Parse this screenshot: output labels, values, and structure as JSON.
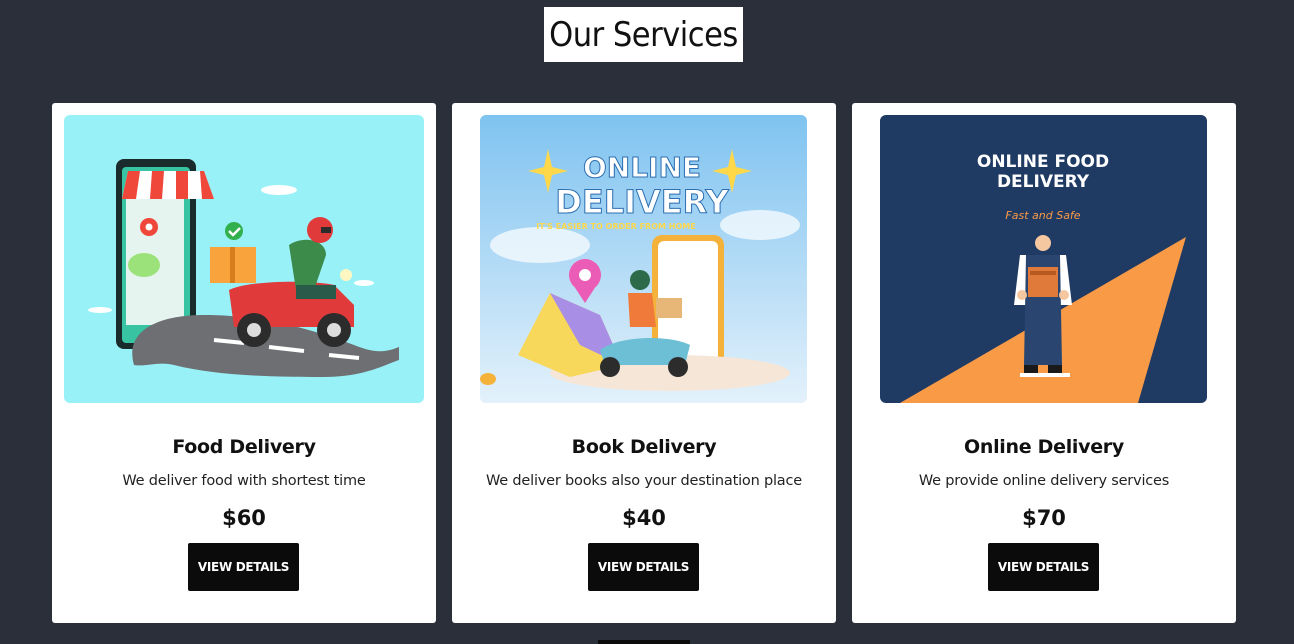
{
  "page": {
    "title": "Our Services"
  },
  "cards": [
    {
      "title": "Food Delivery",
      "description": "We deliver food with shortest time",
      "price": "$60",
      "button_label": "VIEW DETAILS",
      "image": {
        "icon": "scooter-delivery-illustration",
        "bg": "#98f1f6"
      }
    },
    {
      "title": "Book Delivery",
      "description": "We deliver books also your destination place",
      "price": "$40",
      "button_label": "VIEW DETAILS",
      "image": {
        "icon": "online-delivery-banner",
        "headline_1": "ONLINE",
        "headline_2": "DELIVERY",
        "tagline": "IT'S EASIER TO ORDER FROM HOME",
        "bg": "#bfe1f7"
      }
    },
    {
      "title": "Online Delivery",
      "description": "We provide online delivery services",
      "price": "$70",
      "button_label": "VIEW DETAILS",
      "image": {
        "icon": "delivery-man-illustration",
        "headline_1": "ONLINE FOOD",
        "headline_2": "DELIVERY",
        "tagline": "Fast and Safe",
        "bg": "#1f3a63",
        "accent": "#f99a47"
      }
    }
  ]
}
